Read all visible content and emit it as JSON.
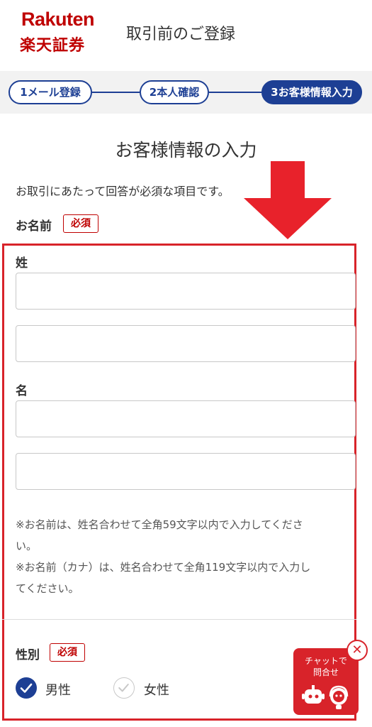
{
  "header": {
    "logo_en": "Rakuten",
    "logo_jp": "楽天証券",
    "title": "取引前のご登録"
  },
  "steps": [
    {
      "label": "1メール登録",
      "state": "done"
    },
    {
      "label": "2本人確認",
      "state": "done"
    },
    {
      "label": "3お客様情報入力",
      "state": "active"
    }
  ],
  "form": {
    "section_title": "お客様情報の入力",
    "intro": "お取引にあたって回答が必須な項目です。",
    "name_label": "お名前",
    "required_badge": "必須",
    "sei_label": "姓",
    "mei_label": "名",
    "sei_kanji": {
      "value": "",
      "placeholder": ""
    },
    "sei_kana": {
      "value": "",
      "placeholder": ""
    },
    "mei_kanji": {
      "value": "",
      "placeholder": ""
    },
    "mei_kana": {
      "value": "",
      "placeholder": ""
    },
    "note1_line1": "※お名前は、姓名合わせて全角59文字以内で入力してくださ",
    "note1_line2": "い。",
    "note2_line1": "※お名前（カナ）は、姓名合わせて全角119文字以内で入力し",
    "note2_line2": "てください。",
    "gender_label": "性別",
    "gender_options": [
      {
        "label": "男性",
        "selected": true
      },
      {
        "label": "女性",
        "selected": false
      }
    ]
  },
  "chat": {
    "line1": "チャットで",
    "line2": "問合せ",
    "close_icon": "close-icon"
  },
  "colors": {
    "brand_red": "#bf0000",
    "step_blue": "#1d3f94",
    "highlight_red": "#d8232a"
  }
}
